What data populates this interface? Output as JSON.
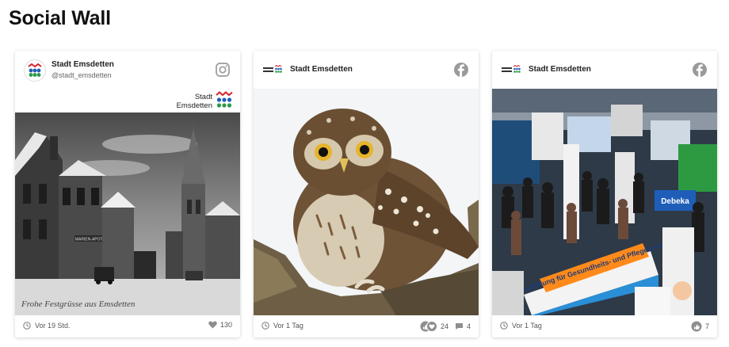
{
  "page": {
    "title": "Social Wall"
  },
  "posts": [
    {
      "author": "Stadt Emsdetten",
      "handle": "@stadt_emsdetten",
      "network": "instagram",
      "brand_line1": "Stadt",
      "brand_line2": "Emsdetten",
      "image_caption": "Frohe Festgrüsse aus Emsdetten",
      "building_sign": "MARIEN-APOTHEKE",
      "time": "Vor 19 Std.",
      "likes": "130"
    },
    {
      "author": "Stadt Emsdetten",
      "network": "facebook",
      "time": "Vor 1 Tag",
      "reactions": "24",
      "comments": "4"
    },
    {
      "author": "Stadt Emsdetten",
      "network": "facebook",
      "time": "Vor 1 Tag",
      "reactions": "7",
      "banner_text": "Ausbildung für Gesundheits- und Pflegeberufe",
      "sign_text": "Debeka"
    }
  ],
  "colors": {
    "accent_blue": "#1e5eb8",
    "accent_green": "#2e9a48",
    "accent_red": "#d2232a",
    "icon_gray": "#9a9a9a"
  }
}
